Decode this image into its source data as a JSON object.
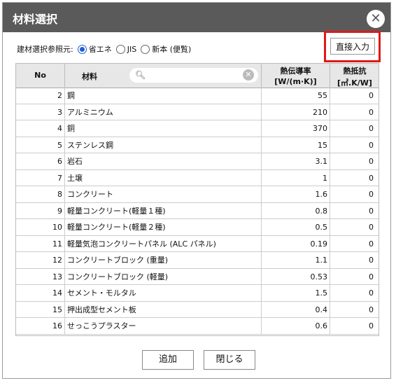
{
  "dialog": {
    "title": "材料選択",
    "close_symbol": "✕"
  },
  "reference": {
    "label": "建材選択参照元:",
    "options": [
      {
        "label": "省エネ",
        "selected": true
      },
      {
        "label": "JIS",
        "selected": false
      },
      {
        "label": "新本 (便覧)",
        "selected": false
      }
    ]
  },
  "direct_input_label": "直接入力",
  "table": {
    "headers": {
      "no": "No",
      "name": "材料",
      "cond_l1": "熱伝導率",
      "cond_l2": "[W/(m·K)]",
      "res_l1": "熱抵抗",
      "res_l2": "[㎡.K/W]"
    },
    "search": {
      "value": "",
      "placeholder": ""
    },
    "rows": [
      {
        "no": "2",
        "name": "鋼",
        "cond": "55",
        "res": "0"
      },
      {
        "no": "3",
        "name": "アルミニウム",
        "cond": "210",
        "res": "0"
      },
      {
        "no": "4",
        "name": "銅",
        "cond": "370",
        "res": "0"
      },
      {
        "no": "5",
        "name": "ステンレス鋼",
        "cond": "15",
        "res": "0"
      },
      {
        "no": "6",
        "name": "岩石",
        "cond": "3.1",
        "res": "0"
      },
      {
        "no": "7",
        "name": "土壌",
        "cond": "1",
        "res": "0"
      },
      {
        "no": "8",
        "name": "コンクリート",
        "cond": "1.6",
        "res": "0"
      },
      {
        "no": "9",
        "name": "軽量コンクリート(軽量１種)",
        "cond": "0.8",
        "res": "0"
      },
      {
        "no": "10",
        "name": "軽量コンクリート(軽量２種)",
        "cond": "0.5",
        "res": "0"
      },
      {
        "no": "11",
        "name": "軽量気泡コンクリートパネル (ALC パネル)",
        "cond": "0.19",
        "res": "0"
      },
      {
        "no": "12",
        "name": "コンクリートブロック (重量)",
        "cond": "1.1",
        "res": "0"
      },
      {
        "no": "13",
        "name": "コンクリートブロック (軽量)",
        "cond": "0.53",
        "res": "0"
      },
      {
        "no": "14",
        "name": "セメント・モルタル",
        "cond": "1.5",
        "res": "0"
      },
      {
        "no": "15",
        "name": "押出成型セメント板",
        "cond": "0.4",
        "res": "0"
      },
      {
        "no": "16",
        "name": "せっこうプラスター",
        "cond": "0.6",
        "res": "0"
      }
    ]
  },
  "buttons": {
    "add": "追加",
    "close": "閉じる"
  },
  "colors": {
    "titlebar": "#5a5a5a",
    "radio_selected": "#1f5fd6",
    "highlight_border": "#e01818"
  }
}
